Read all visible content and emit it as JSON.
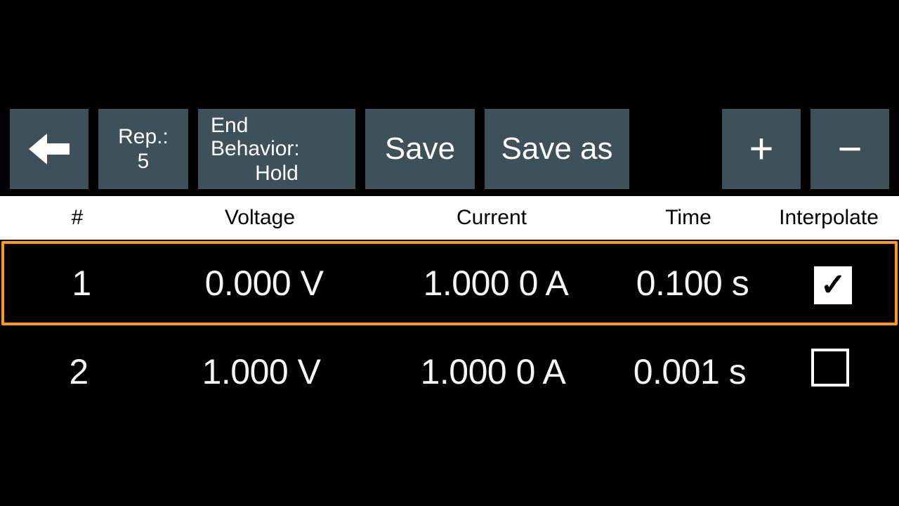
{
  "toolbar": {
    "rep_label": "Rep.:",
    "rep_value": "5",
    "end_label": "End Behavior:",
    "end_value": "Hold",
    "save_label": "Save",
    "saveas_label": "Save as",
    "plus_label": "+",
    "minus_label": "−"
  },
  "headers": {
    "index": "#",
    "voltage": "Voltage",
    "current": "Current",
    "time": "Time",
    "interpolate": "Interpolate"
  },
  "rows": [
    {
      "index": "1",
      "voltage": "0.000 V",
      "current": "1.000 0 A",
      "time": "0.100 s",
      "interpolate": true,
      "selected": true
    },
    {
      "index": "2",
      "voltage": "1.000 V",
      "current": "1.000 0 A",
      "time": "0.001 s",
      "interpolate": false,
      "selected": false
    }
  ]
}
